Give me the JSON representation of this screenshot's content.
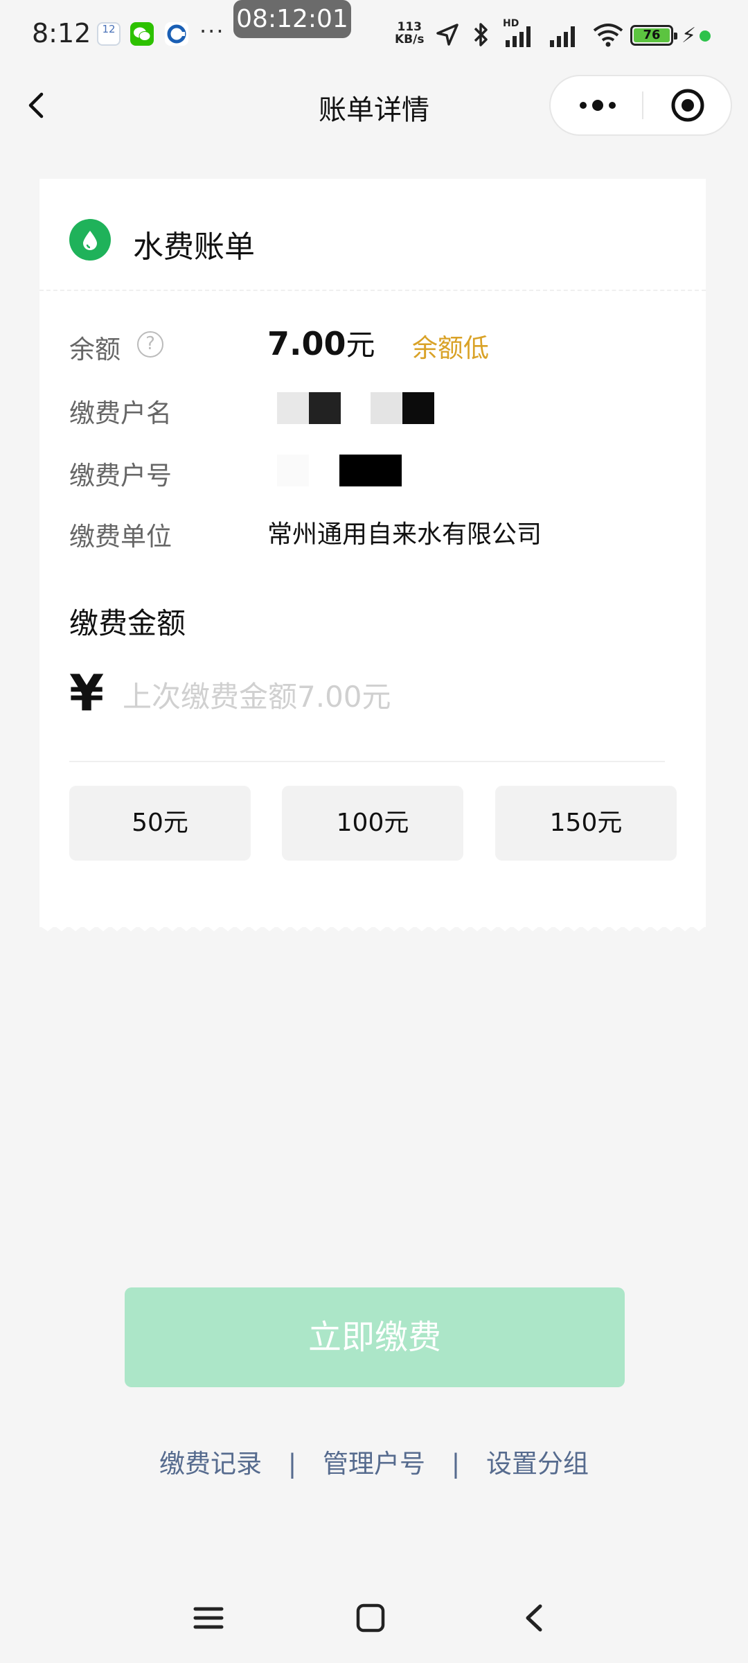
{
  "status_bar": {
    "time": "8:12",
    "clock_overlay": "08:12:01",
    "calendar_day": "12",
    "net_speed_value": "113",
    "net_speed_unit": "KB/s",
    "signal_label": "HD",
    "battery": "76",
    "dots": "···"
  },
  "nav": {
    "title": "账单详情"
  },
  "card": {
    "title": "水费账单",
    "balance_label": "余额",
    "balance_help": "?",
    "balance_value": "7.00",
    "balance_unit": "元",
    "balance_tag": "余额低",
    "account_name_label": "缴费户名",
    "account_number_label": "缴费户号",
    "company_label": "缴费单位",
    "company_value": "常州通用自来水有限公司"
  },
  "amount": {
    "title": "缴费金额",
    "currency_symbol": "¥",
    "placeholder": "上次缴费金额7.00元",
    "quick_options": [
      "50元",
      "100元",
      "150元"
    ]
  },
  "pay_button_label": "立即缴费",
  "links": [
    "缴费记录",
    "管理户号",
    "设置分组"
  ],
  "link_separator": "|",
  "colors": {
    "brand_green": "#1fb25a",
    "pay_button_disabled": "#ace6c8",
    "warning": "#d9a227",
    "link": "#566b8e"
  },
  "icons": {
    "nav_back": "chevron-left-icon",
    "more": "more-dots-icon",
    "close": "target-circle-icon",
    "card": "water-drop-icon",
    "home_menu": "menu-icon",
    "home_home": "square-home-icon",
    "home_back": "chevron-left-icon"
  }
}
